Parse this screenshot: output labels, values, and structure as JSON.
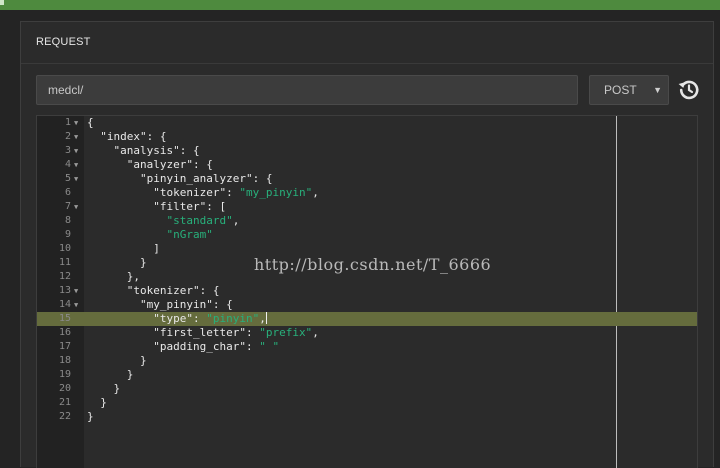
{
  "panel": {
    "title": "REQUEST"
  },
  "request": {
    "url": "medcl/",
    "method": "POST"
  },
  "editor": {
    "active_line": 15,
    "lines": [
      {
        "n": "1",
        "fold": true,
        "parts": [
          [
            "p",
            "{"
          ]
        ]
      },
      {
        "n": "2",
        "fold": true,
        "parts": [
          [
            "p",
            "  "
          ],
          [
            "k",
            "\"index\""
          ],
          [
            "p",
            ": {"
          ]
        ]
      },
      {
        "n": "3",
        "fold": true,
        "parts": [
          [
            "p",
            "    "
          ],
          [
            "k",
            "\"analysis\""
          ],
          [
            "p",
            ": {"
          ]
        ]
      },
      {
        "n": "4",
        "fold": true,
        "parts": [
          [
            "p",
            "      "
          ],
          [
            "k",
            "\"analyzer\""
          ],
          [
            "p",
            ": {"
          ]
        ]
      },
      {
        "n": "5",
        "fold": true,
        "parts": [
          [
            "p",
            "        "
          ],
          [
            "k",
            "\"pinyin_analyzer\""
          ],
          [
            "p",
            ": {"
          ]
        ]
      },
      {
        "n": "6",
        "fold": false,
        "parts": [
          [
            "p",
            "          "
          ],
          [
            "k",
            "\"tokenizer\""
          ],
          [
            "p",
            ": "
          ],
          [
            "s",
            "\"my_pinyin\""
          ],
          [
            "p",
            ","
          ]
        ]
      },
      {
        "n": "7",
        "fold": true,
        "parts": [
          [
            "p",
            "          "
          ],
          [
            "k",
            "\"filter\""
          ],
          [
            "p",
            ": ["
          ]
        ]
      },
      {
        "n": "8",
        "fold": false,
        "parts": [
          [
            "p",
            "            "
          ],
          [
            "s",
            "\"standard\""
          ],
          [
            "p",
            ","
          ]
        ]
      },
      {
        "n": "9",
        "fold": false,
        "parts": [
          [
            "p",
            "            "
          ],
          [
            "s",
            "\"nGram\""
          ]
        ]
      },
      {
        "n": "10",
        "fold": false,
        "parts": [
          [
            "p",
            "          ]"
          ]
        ]
      },
      {
        "n": "11",
        "fold": false,
        "parts": [
          [
            "p",
            "        }"
          ]
        ]
      },
      {
        "n": "12",
        "fold": false,
        "parts": [
          [
            "p",
            "      },"
          ]
        ]
      },
      {
        "n": "13",
        "fold": true,
        "parts": [
          [
            "p",
            "      "
          ],
          [
            "k",
            "\"tokenizer\""
          ],
          [
            "p",
            ": {"
          ]
        ]
      },
      {
        "n": "14",
        "fold": true,
        "parts": [
          [
            "p",
            "        "
          ],
          [
            "k",
            "\"my_pinyin\""
          ],
          [
            "p",
            ": {"
          ]
        ]
      },
      {
        "n": "15",
        "fold": false,
        "parts": [
          [
            "p",
            "          "
          ],
          [
            "k",
            "\"type\""
          ],
          [
            "p",
            ": "
          ],
          [
            "s",
            "\"pinyin\""
          ],
          [
            "p",
            ","
          ]
        ]
      },
      {
        "n": "16",
        "fold": false,
        "parts": [
          [
            "p",
            "          "
          ],
          [
            "k",
            "\"first_letter\""
          ],
          [
            "p",
            ": "
          ],
          [
            "s",
            "\"prefix\""
          ],
          [
            "p",
            ","
          ]
        ]
      },
      {
        "n": "17",
        "fold": false,
        "parts": [
          [
            "p",
            "          "
          ],
          [
            "k",
            "\"padding_char\""
          ],
          [
            "p",
            ": "
          ],
          [
            "s",
            "\" \""
          ]
        ]
      },
      {
        "n": "18",
        "fold": false,
        "parts": [
          [
            "p",
            "        }"
          ]
        ]
      },
      {
        "n": "19",
        "fold": false,
        "parts": [
          [
            "p",
            "      }"
          ]
        ]
      },
      {
        "n": "20",
        "fold": false,
        "parts": [
          [
            "p",
            "    }"
          ]
        ]
      },
      {
        "n": "21",
        "fold": false,
        "parts": [
          [
            "p",
            "  }"
          ]
        ]
      },
      {
        "n": "22",
        "fold": false,
        "parts": [
          [
            "p",
            "}"
          ]
        ]
      }
    ]
  },
  "watermark": "http://blog.csdn.net/T_6666",
  "icons": {
    "history": "history-icon",
    "fold": "fold-arrow-icon",
    "caret": "caret-down-icon"
  },
  "colors": {
    "top_bar": "#4e8a3e",
    "string": "#28b07b",
    "active_line": "#656c3d"
  }
}
